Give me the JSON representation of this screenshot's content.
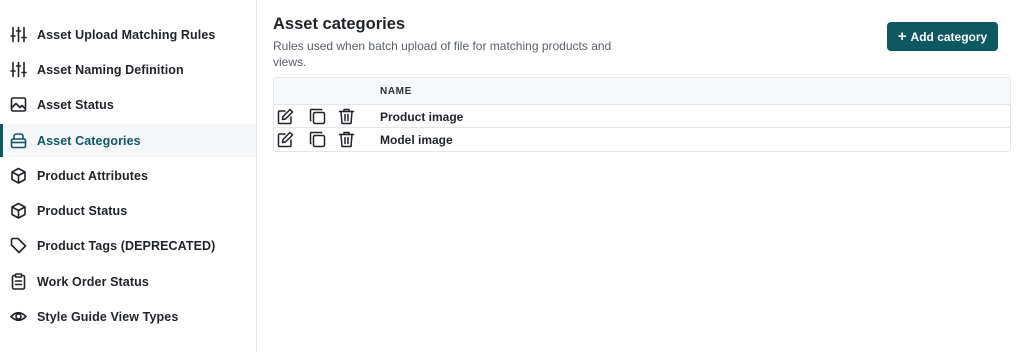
{
  "sidebar": {
    "items": [
      {
        "label": "Asset Upload Matching Rules",
        "icon": "sliders-icon"
      },
      {
        "label": "Asset Naming Definition",
        "icon": "sliders-icon"
      },
      {
        "label": "Asset Status",
        "icon": "image-icon"
      },
      {
        "label": "Asset Categories",
        "icon": "basket-icon",
        "active": true
      },
      {
        "label": "Product Attributes",
        "icon": "box-icon"
      },
      {
        "label": "Product Status",
        "icon": "box-icon"
      },
      {
        "label": "Product Tags (DEPRECATED)",
        "icon": "tag-icon"
      },
      {
        "label": "Work Order Status",
        "icon": "clipboard-icon"
      },
      {
        "label": "Style Guide View Types",
        "icon": "eye-icon"
      }
    ]
  },
  "main": {
    "title": "Asset categories",
    "description": "Rules used when batch upload of file for matching products and views.",
    "add_button": {
      "plus": "+",
      "label": "Add category"
    },
    "table": {
      "columns": [
        "NAME"
      ],
      "rows": [
        {
          "name": "Product image"
        },
        {
          "name": "Model image"
        }
      ]
    }
  },
  "colors": {
    "accent": "#0e5961",
    "active_bg": "#f5f7f8",
    "border": "#e3e6e9"
  }
}
